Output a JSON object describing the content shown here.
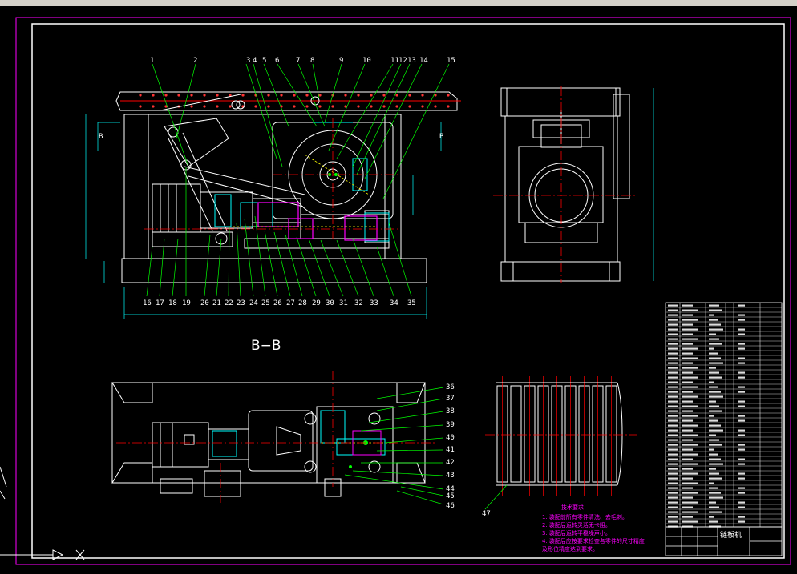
{
  "toolbar": {
    "icons": [
      "folder-icon",
      "save-icon",
      "print-icon",
      "undo-icon",
      "redo-icon",
      "copy-icon",
      "paste-icon",
      "zoom-icon",
      "pan-icon",
      "properties-icon",
      "layer-icon"
    ]
  },
  "drawing": {
    "section_label": "B−B",
    "colors": {
      "frame": "#ff00ff",
      "border": "#ffffff",
      "leader": "#00ff00",
      "center": "#ff0000",
      "hidden": "#ffff00",
      "dimension": "#00ffff",
      "background": "#000000"
    },
    "balloons_top": [
      "1",
      "2",
      "3",
      "4",
      "5",
      "6",
      "7",
      "8",
      "9",
      "10",
      "11",
      "12",
      "13",
      "14",
      "15"
    ],
    "balloons_bottom": [
      "16",
      "17",
      "18",
      "19",
      "20",
      "21",
      "22",
      "23",
      "24",
      "25",
      "26",
      "27",
      "28",
      "29",
      "30",
      "31",
      "32",
      "33",
      "34",
      "35"
    ],
    "balloons_right": [
      "36",
      "37",
      "38",
      "39",
      "40",
      "41",
      "42",
      "43",
      "44",
      "45",
      "46"
    ],
    "balloon_left": "47",
    "notes": {
      "heading": "技术要求",
      "lines": [
        "1. 装配前所有零件清洗、去毛刺。",
        "2. 装配后运转灵活无卡阻。",
        "3. 装配后运转平稳噪声小。",
        "4. 装配后应按要求检查各零件的尺寸精度",
        "及形位精度达到要求。"
      ]
    },
    "title_block": {
      "name": "链板机"
    }
  }
}
